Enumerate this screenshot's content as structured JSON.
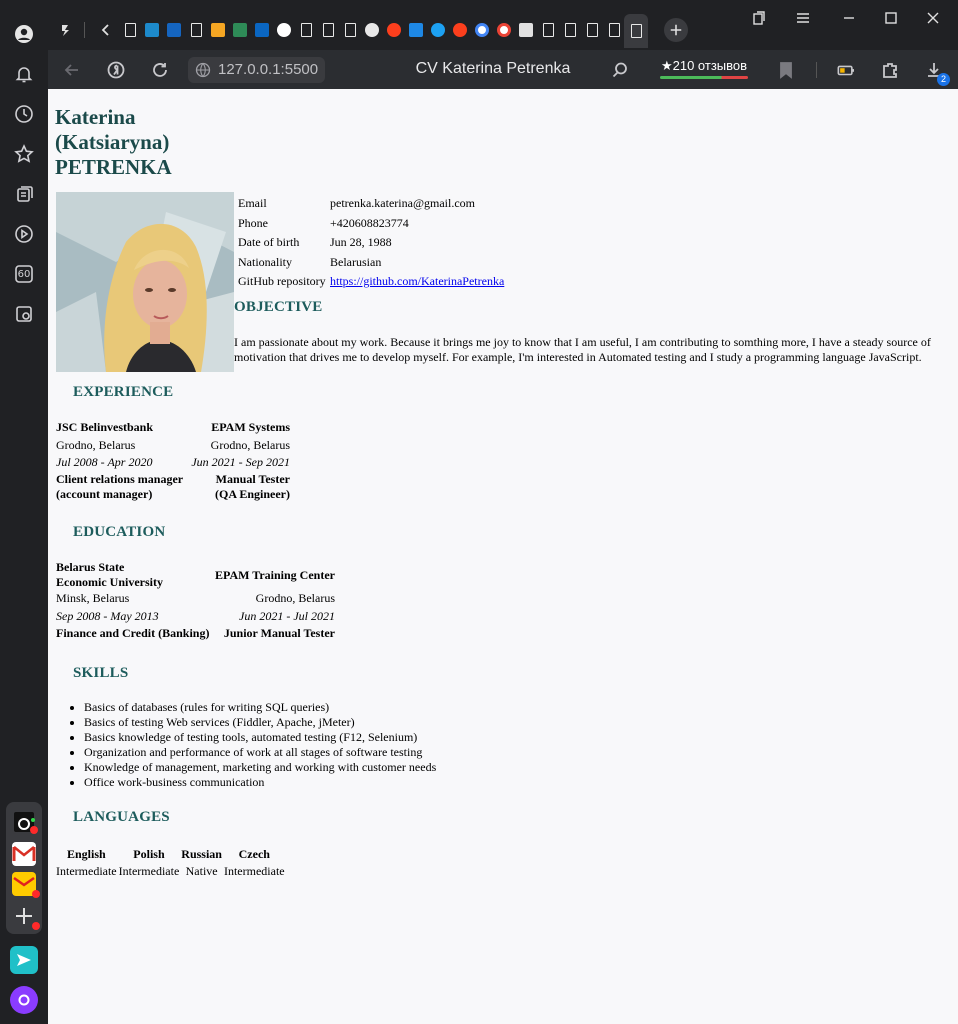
{
  "browser": {
    "address": "127.0.0.1:5500",
    "title": "CV Katerina Petrenka",
    "reviews": "★210 отзывов",
    "downloads_badge": "2",
    "sidebar_badge": "60"
  },
  "cv": {
    "name_line1": "Katerina",
    "name_line2": "(Katsiaryna)",
    "name_line3": "PETRENKA",
    "contacts": [
      {
        "key": "Email",
        "value": "petrenka.katerina@gmail.com"
      },
      {
        "key": "Phone",
        "value": "+420608823774"
      },
      {
        "key": "Date of birth",
        "value": "Jun 28, 1988"
      },
      {
        "key": "Nationality",
        "value": "Belarusian"
      },
      {
        "key": "GitHub repository",
        "value": "https://github.com/KaterinaPetrenka"
      }
    ],
    "objective_title": "OBJECTIVE",
    "objective_text": "I am passionate about my work. Because it brings me joy to know that I am useful, I am contributing to somthing more, I have a steady source of motivation that drives me to develop myself. For example, I'm interested in Automated testing and I study a programming language JavaScript.",
    "experience_title": "EXPERIENCE",
    "experience": [
      {
        "org": "JSC Belinvestbank",
        "place": "Grodno, Belarus",
        "dates": "Jul 2008 - Apr 2020",
        "role_line1": "Client relations manager",
        "role_line2": "(account manager)"
      },
      {
        "org": "EPAM Systems",
        "place": "Grodno, Belarus",
        "dates": "Jun 2021 - Sep 2021",
        "role_line1": "Manual Tester",
        "role_line2": "(QA Engineer)"
      }
    ],
    "education_title": "EDUCATION",
    "education": [
      {
        "org_line1": "Belarus State",
        "org_line2": "Economic University",
        "place": "Minsk, Belarus",
        "dates": "Sep 2008 - May 2013",
        "field": "Finance and Credit (Banking)"
      },
      {
        "org": "EPAM Training Center",
        "place": "Grodno, Belarus",
        "dates": "Jun 2021 - Jul 2021",
        "field": "Junior Manual Tester"
      }
    ],
    "skills_title": "SKILLS",
    "skills": [
      "Basics of databases (rules for writing SQL queries)",
      "Basics of testing Web services (Fiddler, Apache, jMeter)",
      "Basics knowledge of testing tools, automated testing (F12, Selenium)",
      "Organization and performance of work at all stages of software testing",
      "Knowledge of management, marketing and working with customer needs",
      "Office work-business communication"
    ],
    "languages_title": "LANGUAGES",
    "languages": [
      {
        "name": "English",
        "level": "Intermediate"
      },
      {
        "name": "Polish",
        "level": "Intermediate"
      },
      {
        "name": "Russian",
        "level": "Native"
      },
      {
        "name": "Czech",
        "level": "Intermediate"
      }
    ]
  }
}
